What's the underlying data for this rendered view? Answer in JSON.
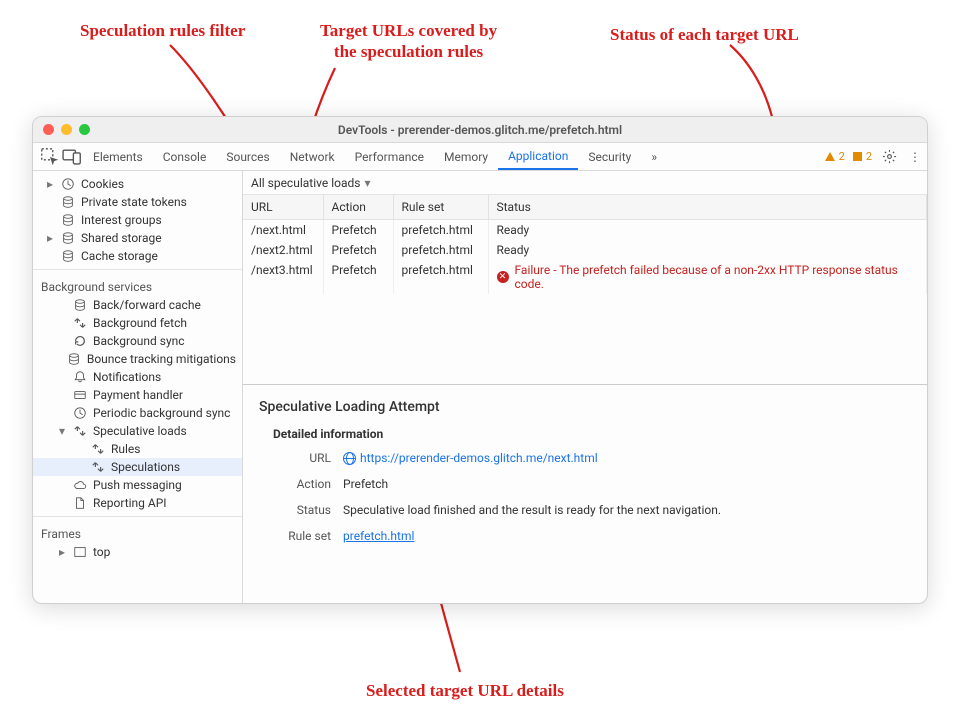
{
  "annotations": {
    "filter": "Speculation rules filter",
    "targets": "Target URLs covered by\nthe speculation rules",
    "status": "Status of each target URL",
    "details": "Selected target URL details"
  },
  "window": {
    "title": "DevTools - prerender-demos.glitch.me/prefetch.html"
  },
  "tabs": {
    "items": [
      "Elements",
      "Console",
      "Sources",
      "Network",
      "Performance",
      "Memory",
      "Application",
      "Security"
    ],
    "active": "Application",
    "overflow": "»",
    "warn1_count": "2",
    "warn2_count": "2"
  },
  "sidebar": {
    "top": [
      {
        "icon": "clock",
        "label": "Cookies",
        "expand": true
      },
      {
        "icon": "db",
        "label": "Private state tokens"
      },
      {
        "icon": "db",
        "label": "Interest groups"
      },
      {
        "icon": "db",
        "label": "Shared storage",
        "expand": true
      },
      {
        "icon": "db",
        "label": "Cache storage"
      }
    ],
    "bg_header": "Background services",
    "bg": [
      {
        "icon": "db",
        "label": "Back/forward cache"
      },
      {
        "icon": "sync",
        "label": "Background fetch"
      },
      {
        "icon": "refresh",
        "label": "Background sync"
      },
      {
        "icon": "db",
        "label": "Bounce tracking mitigations"
      },
      {
        "icon": "bell",
        "label": "Notifications"
      },
      {
        "icon": "card",
        "label": "Payment handler"
      },
      {
        "icon": "clock",
        "label": "Periodic background sync"
      },
      {
        "icon": "sync",
        "label": "Speculative loads",
        "expanded": true,
        "children": [
          {
            "icon": "sync",
            "label": "Rules"
          },
          {
            "icon": "sync",
            "label": "Speculations",
            "selected": true
          }
        ]
      },
      {
        "icon": "cloud",
        "label": "Push messaging"
      },
      {
        "icon": "doc",
        "label": "Reporting API"
      }
    ],
    "frames_header": "Frames",
    "frames": [
      {
        "icon": "frame",
        "label": "top",
        "expand": true
      }
    ]
  },
  "filter": {
    "label": "All speculative loads"
  },
  "table": {
    "headers": [
      "URL",
      "Action",
      "Rule set",
      "Status"
    ],
    "rows": [
      {
        "url": "/next.html",
        "action": "Prefetch",
        "ruleset": "prefetch.html",
        "status": "Ready",
        "fail": false
      },
      {
        "url": "/next2.html",
        "action": "Prefetch",
        "ruleset": "prefetch.html",
        "status": "Ready",
        "fail": false
      },
      {
        "url": "/next3.html",
        "action": "Prefetch",
        "ruleset": "prefetch.html",
        "status": "Failure - The prefetch failed because of a non-2xx HTTP response status code.",
        "fail": true
      }
    ]
  },
  "detail": {
    "title": "Speculative Loading Attempt",
    "section": "Detailed information",
    "url_label": "URL",
    "url_value": "https://prerender-demos.glitch.me/next.html",
    "action_label": "Action",
    "action_value": "Prefetch",
    "status_label": "Status",
    "status_value": "Speculative load finished and the result is ready for the next navigation.",
    "ruleset_label": "Rule set",
    "ruleset_value": "prefetch.html"
  }
}
